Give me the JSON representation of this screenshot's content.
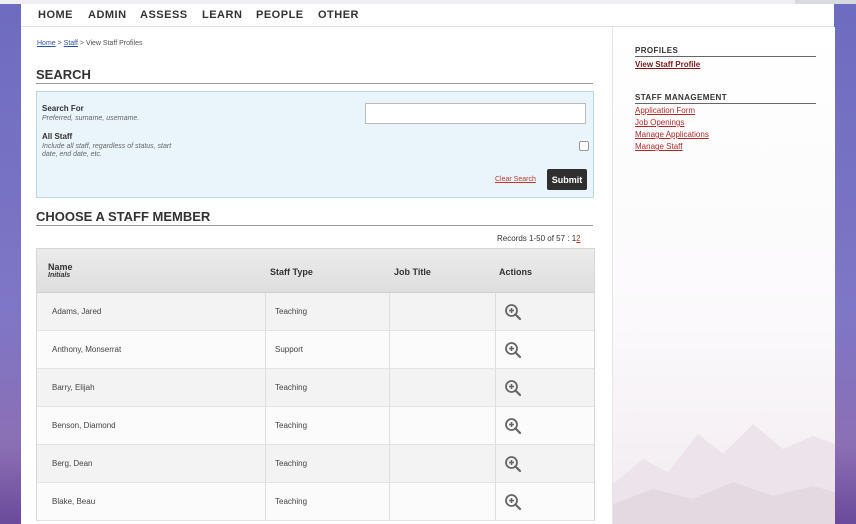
{
  "nav": {
    "items": [
      "HOME",
      "ADMIN",
      "ASSESS",
      "LEARN",
      "PEOPLE",
      "OTHER"
    ]
  },
  "breadcrumb": {
    "home": "Home",
    "sep1": " > ",
    "staff": "Staff",
    "sep2": " > ",
    "current": "View Staff Profiles"
  },
  "search": {
    "title": "SEARCH",
    "search_for_label": "Search For",
    "search_for_hint": "Preferred, surname, username.",
    "search_value": "",
    "all_staff_label": "All Staff",
    "all_staff_hint_1": "Include all staff, regardless of status, start",
    "all_staff_hint_2": "date, end date, etc.",
    "clear_label": "Clear Search",
    "submit_label": "Submit"
  },
  "choose": {
    "title": "CHOOSE A STAFF MEMBER",
    "records_text": "Records 1-50 of 57 : 1",
    "page2": "2"
  },
  "table": {
    "col_name": "Name",
    "col_name_sub": "Initials",
    "col_type": "Staff Type",
    "col_job": "Job Title",
    "col_actions": "Actions",
    "rows": [
      {
        "name": "Adams, Jared",
        "type": "Teaching",
        "job": ""
      },
      {
        "name": "Anthony, Monserrat",
        "type": "Support",
        "job": ""
      },
      {
        "name": "Barry, Elijah",
        "type": "Teaching",
        "job": ""
      },
      {
        "name": "Benson, Diamond",
        "type": "Teaching",
        "job": ""
      },
      {
        "name": "Berg, Dean",
        "type": "Teaching",
        "job": ""
      },
      {
        "name": "Blake, Beau",
        "type": "Teaching",
        "job": ""
      }
    ],
    "action_icon": "zoom-in-icon"
  },
  "sidebar": {
    "profiles_title": "PROFILES",
    "view_staff_profile": "View Staff Profile",
    "mgmt_title": "STAFF MANAGEMENT",
    "links": [
      "Application Form",
      "Job Openings",
      "Manage Applications",
      "Manage Staff"
    ]
  },
  "colors": {
    "link_red": "#c0392b",
    "search_bg": "#e9f4fb",
    "submit_bg": "#2f2f2f"
  }
}
